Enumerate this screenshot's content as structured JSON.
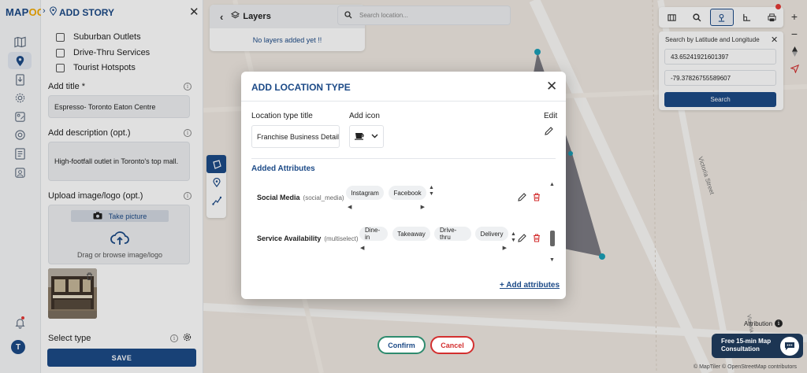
{
  "app": {
    "logo_main": "MAP",
    "logo_accent": "OG"
  },
  "story_panel": {
    "title": "ADD STORY",
    "checkboxes": [
      "Suburban Outlets",
      "Drive-Thru Services",
      "Tourist Hotspots"
    ],
    "add_title_label": "Add title *",
    "add_title_value": "Espresso- Toronto Eaton Centre",
    "add_desc_label": "Add description (opt.)",
    "add_desc_value": "High-footfall outlet in Toronto's top mall.",
    "upload_label": "Upload image/logo (opt.)",
    "take_picture": "Take picture",
    "drag_text": "Drag or browse image/logo",
    "select_type_label": "Select type",
    "save_label": "SAVE"
  },
  "layers": {
    "title": "Layers",
    "empty": "No layers added yet !!"
  },
  "search": {
    "placeholder": "Search location..."
  },
  "latlon": {
    "title": "Search by Latitude and Longitude",
    "lat": "43.65241921601397",
    "lon": "-79.37826755589607",
    "button": "Search"
  },
  "modal": {
    "title": "ADD LOCATION TYPE",
    "type_title_label": "Location type title",
    "type_title_value": "Franchise Business Details",
    "add_icon_label": "Add icon",
    "edit_label": "Edit",
    "added_attributes_label": "Added Attributes",
    "attributes": [
      {
        "name": "Social Media",
        "key": "(social_media)",
        "chips": [
          "Instagram",
          "Facebook"
        ]
      },
      {
        "name": "Service Availability",
        "key": "(multiselect)",
        "chips": [
          "Dine-in",
          "Takeaway",
          "Drive-thru",
          "Delivery"
        ]
      }
    ],
    "add_attributes": "+ Add attributes"
  },
  "actions": {
    "confirm": "Confirm",
    "cancel": "Cancel"
  },
  "consult": {
    "line1": "Free 15-min Map",
    "line2": "Consultation"
  },
  "map": {
    "attribution": "Attribution",
    "copyright": "© MapTiler © OpenStreetMap contributors",
    "street1": "Victoria Street",
    "street2": "Victoria"
  },
  "colors": {
    "brand": "#1c4a87",
    "accent": "#f2a900",
    "danger": "#d32f2f",
    "confirm_border": "#2e8b6e"
  }
}
